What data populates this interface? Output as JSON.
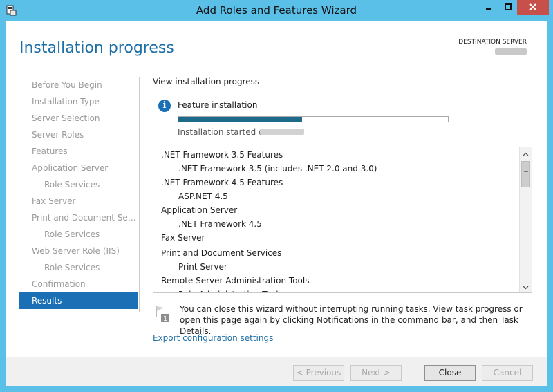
{
  "window": {
    "title": "Add Roles and Features Wizard",
    "icons": [
      "server-manager-app-icon",
      "minimize-icon",
      "maximize-icon",
      "close-icon"
    ]
  },
  "header": {
    "page_title": "Installation progress",
    "destination_label": "DESTINATION SERVER"
  },
  "nav": {
    "items": [
      {
        "label": "Before You Begin"
      },
      {
        "label": "Installation Type"
      },
      {
        "label": "Server Selection"
      },
      {
        "label": "Server Roles"
      },
      {
        "label": "Features"
      },
      {
        "label": "Application Server"
      },
      {
        "label": "Role Services"
      },
      {
        "label": "Fax Server"
      },
      {
        "label": "Print and Document Servi..."
      },
      {
        "label": "Role Services"
      },
      {
        "label": "Web Server Role (IIS)"
      },
      {
        "label": "Role Services"
      },
      {
        "label": "Confirmation"
      },
      {
        "label": "Results"
      }
    ],
    "active_index": 13
  },
  "main": {
    "section_heading": "View installation progress",
    "status": {
      "icon": "info-icon",
      "label": "Feature installation",
      "progress_fraction": 0.46,
      "progress_color": "#1d6a8a",
      "started_prefix": "Installation started on"
    },
    "list": {
      "rows": [
        {
          "text": ".NET Framework 3.5 Features",
          "level": 0
        },
        {
          "text": ".NET Framework 3.5 (includes .NET 2.0 and 3.0)",
          "level": 1
        },
        {
          "text": ".NET Framework 4.5 Features",
          "level": 0
        },
        {
          "text": "ASP.NET 4.5",
          "level": 1
        },
        {
          "text": "Application Server",
          "level": 0
        },
        {
          "text": ".NET Framework 4.5",
          "level": 1
        },
        {
          "text": "Fax Server",
          "level": 0
        },
        {
          "text": "Print and Document Services",
          "level": 0
        },
        {
          "text": "Print Server",
          "level": 1
        },
        {
          "text": "Remote Server Administration Tools",
          "level": 0
        },
        {
          "text": "Role Administration Tools",
          "level": 1
        }
      ]
    },
    "note": {
      "icon": "task-flag-icon",
      "text": "You can close this wizard without interrupting running tasks. View task progress or open this page again by clicking Notifications in the command bar, and then Task Details."
    },
    "export_link": "Export configuration settings"
  },
  "footer": {
    "previous_label": "< Previous",
    "next_label": "Next >",
    "close_label": "Close",
    "cancel_label": "Cancel"
  },
  "colors": {
    "title_bar": "#5bc0e8",
    "accent": "#1a6fb5",
    "close_button": "#c7504a"
  }
}
